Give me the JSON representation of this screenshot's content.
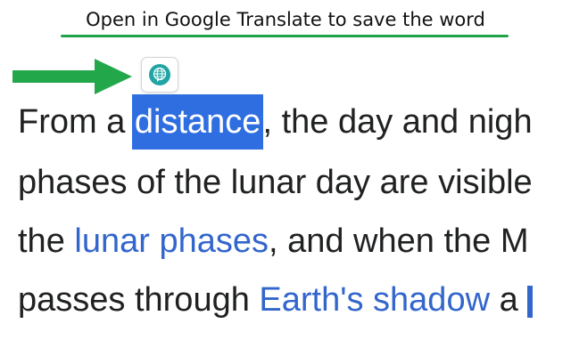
{
  "caption": {
    "text": "Open in Google Translate to save the word",
    "underline_color": "#1fa34a"
  },
  "arrow": {
    "icon": "arrow-right-icon",
    "color": "#22a84a"
  },
  "translate_button": {
    "icon": "google-translate-icon",
    "color": "#20a4a4"
  },
  "article": {
    "line1": {
      "before": "From a ",
      "selected": "distance",
      "after": ", the day and nigh"
    },
    "line2": {
      "text": "phases of the lunar day are visible"
    },
    "line3": {
      "before": "the ",
      "link": "lunar phases",
      "after": ", and when the M"
    },
    "line4": {
      "before": "passes through ",
      "link": "Earth's shadow",
      "after": " a"
    },
    "colors": {
      "text": "#202122",
      "link": "#3366cc",
      "selection": "#2f6ee0"
    }
  }
}
